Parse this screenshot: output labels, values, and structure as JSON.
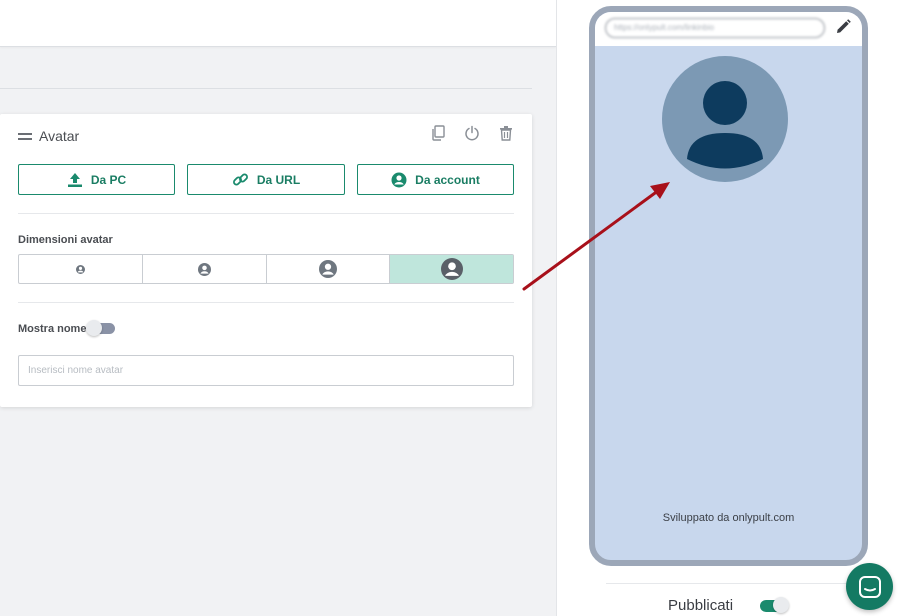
{
  "card": {
    "title": "Avatar",
    "source_buttons": [
      {
        "label": "Da PC",
        "icon": "upload-icon"
      },
      {
        "label": "Da URL",
        "icon": "link-icon"
      },
      {
        "label": "Da account",
        "icon": "account-icon"
      }
    ],
    "size_label": "Dimensioni avatar",
    "sizes": [
      "xs",
      "s",
      "m",
      "l"
    ],
    "selected_size": "l",
    "show_name_label": "Mostra nome",
    "show_name_on": false,
    "name_placeholder": "Inserisci nome avatar"
  },
  "preview": {
    "url": "https://onlypult.com/linkinbio",
    "credit": "Sviluppato da onlypult.com"
  },
  "footer": {
    "published_label": "Pubblicati",
    "published_on": true
  },
  "colors": {
    "accent": "#1a8a6d",
    "preview_bg": "#c8d7ed",
    "avatar_bg": "#7c99b4",
    "avatar_fg": "#0d3b5e",
    "annotation_arrow": "#a8101a"
  }
}
